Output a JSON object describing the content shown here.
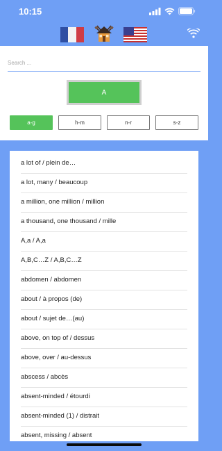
{
  "status_bar": {
    "time": "10:15"
  },
  "header": {
    "left_flag": "french-flag",
    "center_logo": "app-logo",
    "right_flag": "us-flag",
    "wifi_icon": "wifi-icon"
  },
  "search": {
    "placeholder": "Search ...",
    "value": ""
  },
  "letter_button": {
    "label": "A"
  },
  "range_tabs": [
    {
      "label": "a-g",
      "active": true
    },
    {
      "label": "h-m",
      "active": false
    },
    {
      "label": "n-r",
      "active": false
    },
    {
      "label": "s-z",
      "active": false
    }
  ],
  "words": [
    "a lot of / plein de…",
    "a lot, many / beaucoup",
    "a million, one million / million",
    "a thousand, one thousand / mille",
    "A,a / A,a",
    "A,B,C…Z / A,B,C…Z",
    "abdomen / abdomen",
    "about / à propos (de)",
    "about / sujet de…(au)",
    "above, on top of / dessus",
    "above, over / au-dessus",
    "abscess / abcès",
    "absent-minded / étourdi",
    "absent-minded (1) / distrait",
    "absent, missing / absent"
  ],
  "colors": {
    "background": "#6f9ff5",
    "accent_green": "#55c35a",
    "panel": "#ffffff"
  }
}
